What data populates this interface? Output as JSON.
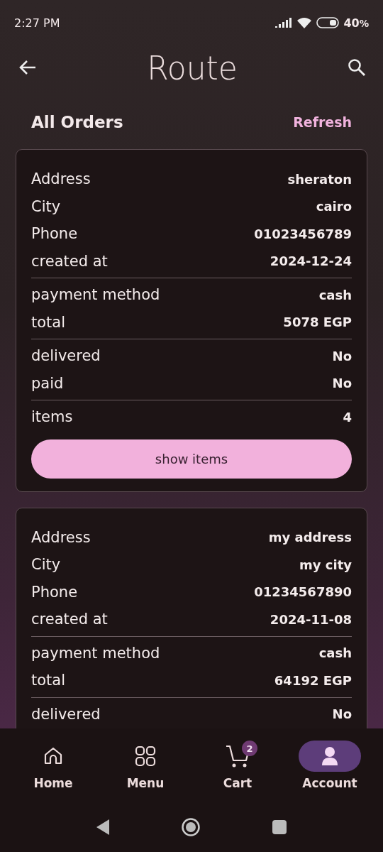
{
  "status_bar": {
    "time": "2:27 PM",
    "battery": "40",
    "battery_unit": "%"
  },
  "header": {
    "logo": "Route"
  },
  "page": {
    "title": "All Orders",
    "refresh": "Refresh"
  },
  "orders": [
    {
      "groups": [
        [
          {
            "label": "Address",
            "value": "sheraton"
          },
          {
            "label": "City",
            "value": "cairo"
          },
          {
            "label": "Phone",
            "value": "01023456789"
          },
          {
            "label": "created at",
            "value": "2024-12-24"
          }
        ],
        [
          {
            "label": "payment method",
            "value": "cash"
          },
          {
            "label": "total",
            "value": "5078 EGP"
          }
        ],
        [
          {
            "label": "delivered",
            "value": "No"
          },
          {
            "label": "paid",
            "value": "No"
          }
        ],
        [
          {
            "label": "items",
            "value": "4"
          }
        ]
      ],
      "button": "show items"
    },
    {
      "groups": [
        [
          {
            "label": "Address",
            "value": "my address"
          },
          {
            "label": "City",
            "value": "my city"
          },
          {
            "label": "Phone",
            "value": "01234567890"
          },
          {
            "label": "created at",
            "value": "2024-11-08"
          }
        ],
        [
          {
            "label": "payment method",
            "value": "cash"
          },
          {
            "label": "total",
            "value": "64192 EGP"
          }
        ],
        [
          {
            "label": "delivered",
            "value": "No"
          }
        ]
      ]
    }
  ],
  "nav": [
    {
      "kind": "home",
      "label": "Home",
      "selected": false
    },
    {
      "kind": "menu",
      "label": "Menu",
      "selected": false
    },
    {
      "kind": "cart",
      "label": "Cart",
      "selected": false,
      "badge": "2"
    },
    {
      "kind": "account",
      "label": "Account",
      "selected": true
    }
  ]
}
